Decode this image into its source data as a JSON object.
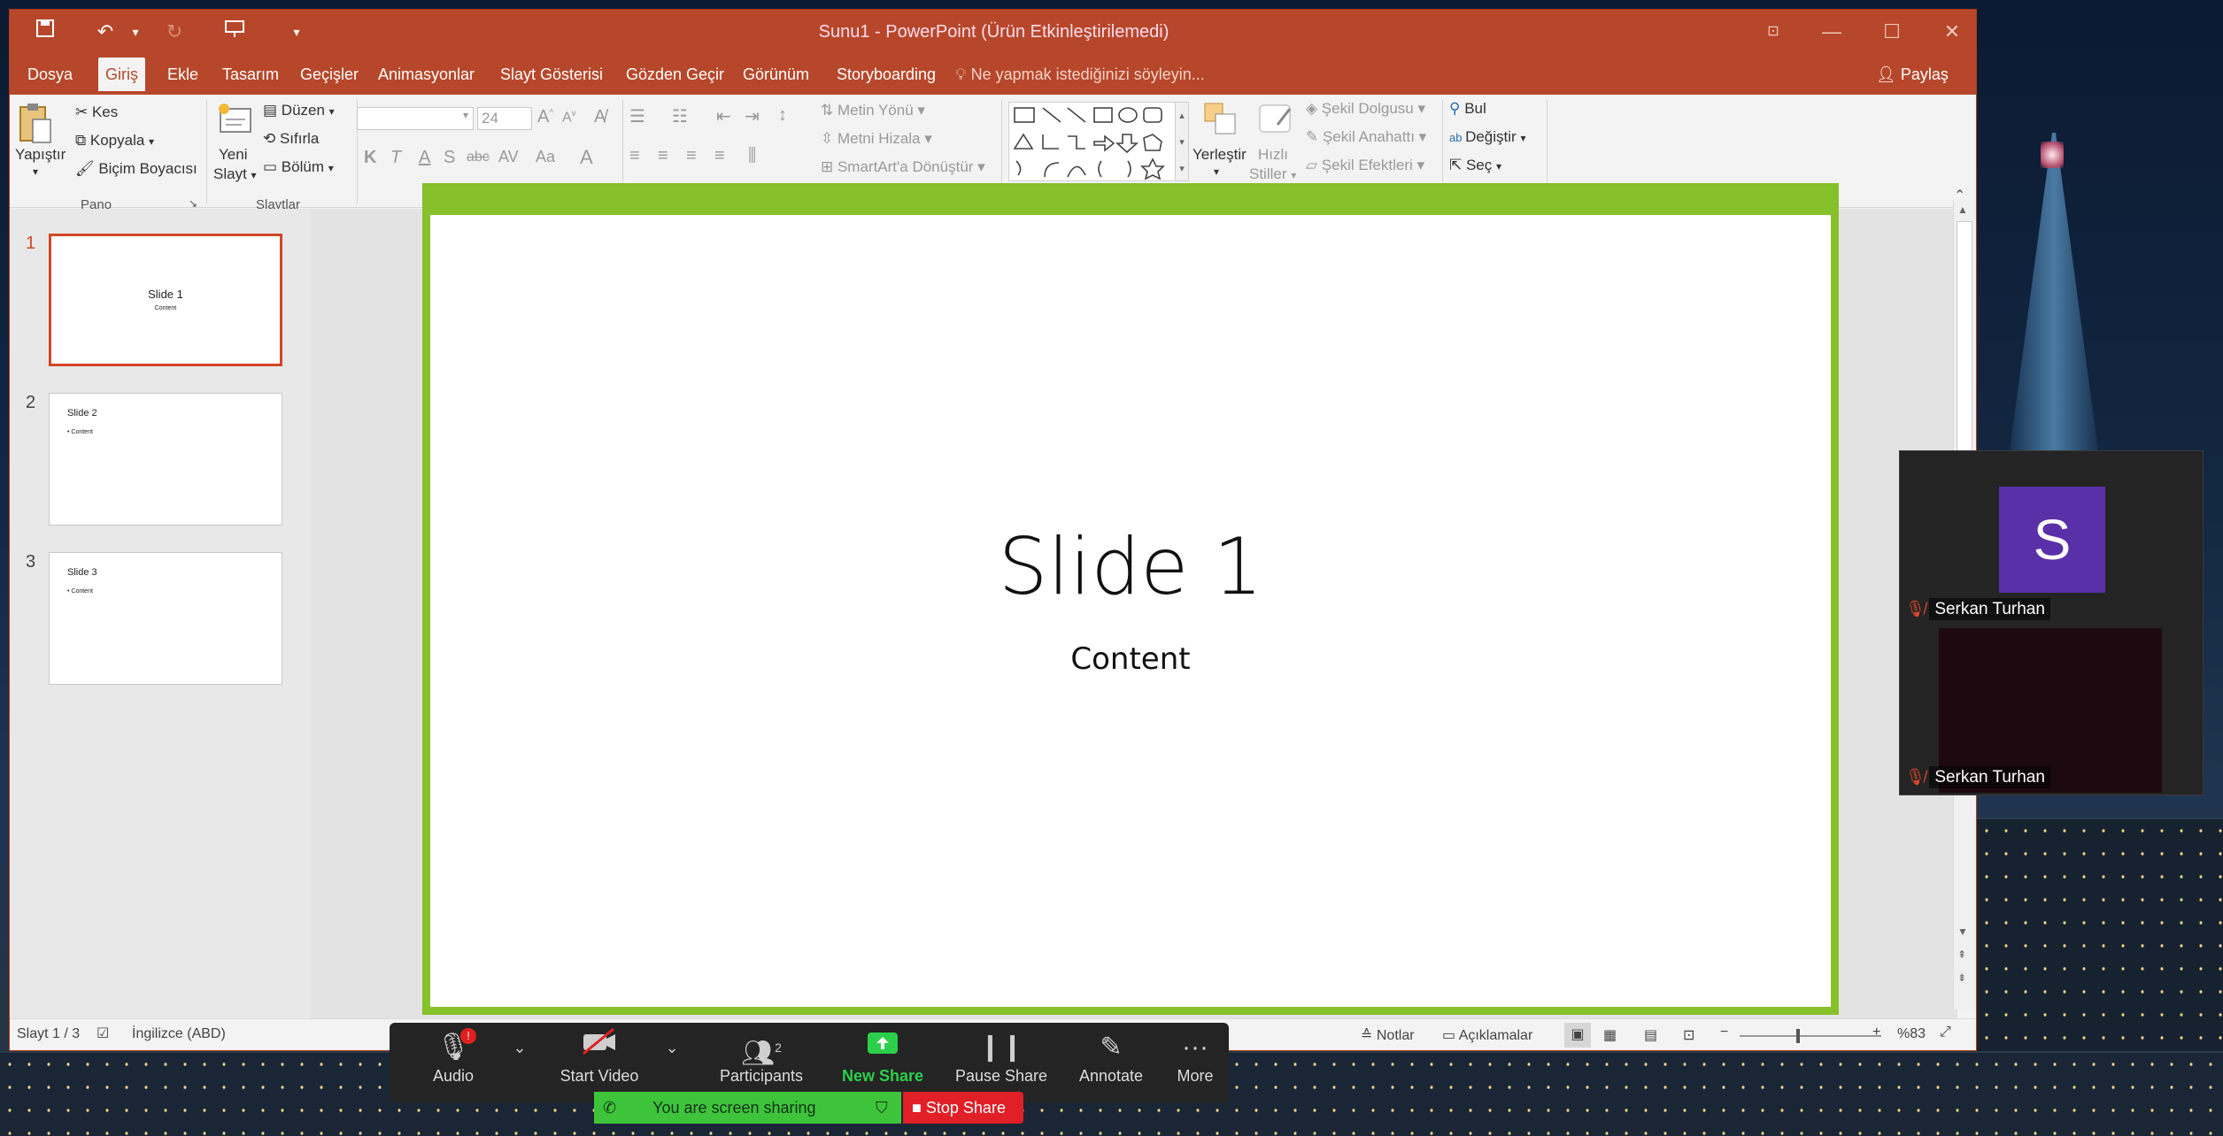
{
  "window": {
    "title": "Sunu1 - PowerPoint (Ürün Etkinleştirilemedi)"
  },
  "quick_access": {
    "save": "save-icon",
    "undo": "undo-icon",
    "redo": "redo-icon",
    "present": "present-icon",
    "customize": "▾"
  },
  "tabs": [
    "Dosya",
    "Giriş",
    "Ekle",
    "Tasarım",
    "Geçişler",
    "Animasyonlar",
    "Slayt Gösterisi",
    "Gözden Geçir",
    "Görünüm",
    "Storyboarding"
  ],
  "active_tab": "Giriş",
  "tell_me": "Ne yapmak istediğinizi söyleyin...",
  "share_label": "Paylaş",
  "ribbon": {
    "pano": {
      "paste": "Yapıştır",
      "cut": "Kes",
      "copy": "Kopyala",
      "format_painter": "Biçim Boyacısı",
      "label": "Pano"
    },
    "slaytlar": {
      "new_slide": "Yeni",
      "new_slide2": "Slayt",
      "layout": "Düzen",
      "reset": "Sıfırla",
      "section": "Bölüm",
      "label": "Slaytlar"
    },
    "font": {
      "name": "",
      "size": "24",
      "bold": "K",
      "italic": "T",
      "underline": "A",
      "shadow": "S",
      "strike": "abc",
      "spacing": "AV",
      "case": "Aa",
      "color": "A"
    },
    "paragraph": {
      "text_direction": "Metin Yönü",
      "align_text": "Metni Hizala",
      "smartart": "SmartArt'a Dönüştür"
    },
    "drawing": {
      "arrange": "Yerleştir",
      "quick_styles": "Hızlı",
      "quick_styles2": "Stiller",
      "shape_fill": "Şekil Dolgusu",
      "shape_outline": "Şekil Anahattı",
      "shape_effects": "Şekil Efektleri"
    },
    "editing": {
      "find": "Bul",
      "replace": "Değiştir",
      "select": "Seç"
    }
  },
  "thumbnails": [
    {
      "num": "1",
      "title": "Slide 1",
      "body": "Content"
    },
    {
      "num": "2",
      "title": "Slide 2",
      "body": "• Content"
    },
    {
      "num": "3",
      "title": "Slide 3",
      "body": "• Content"
    }
  ],
  "slide": {
    "title": "Slide 1",
    "subtitle": "Content"
  },
  "status": {
    "slide_count": "Slayt 1 / 3",
    "language": "İngilizce (ABD)",
    "notes": "Notlar",
    "comments": "Açıklamalar",
    "zoom": "%83",
    "zoom_fraction": 0.83
  },
  "zoom_toolbar": {
    "audio": "Audio",
    "start_video": "Start Video",
    "participants": "Participants",
    "participants_count": "2",
    "new_share": "New Share",
    "pause_share": "Pause Share",
    "annotate": "Annotate",
    "more": "More",
    "alert": "!"
  },
  "sharing": {
    "banner": "You are screen sharing",
    "stop": "Stop Share"
  },
  "video_panel": {
    "avatar_letter": "S",
    "participant1": "Serkan Turhan",
    "participant2": "Serkan Turhan"
  },
  "colors": {
    "accent": "#b7472a",
    "slide_border": "#86c02a",
    "new_share": "#2bcf4a",
    "stop": "#e01f26",
    "avatar": "#5a30a8"
  }
}
